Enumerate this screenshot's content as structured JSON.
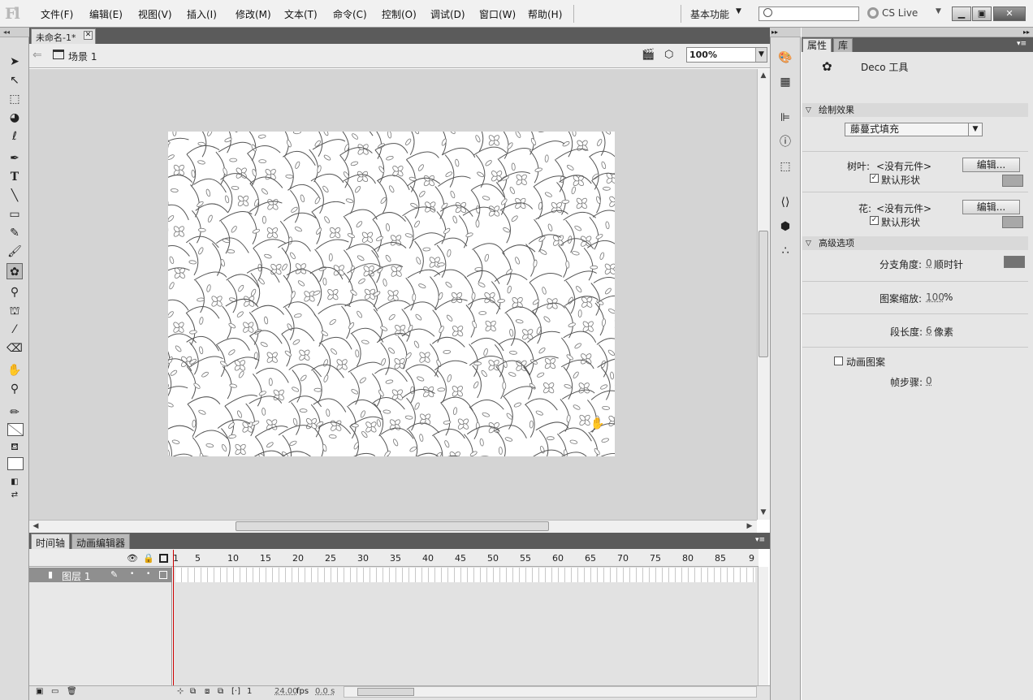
{
  "app": {
    "logo": "Fl"
  },
  "menu": [
    "文件(F)",
    "编辑(E)",
    "视图(V)",
    "插入(I)",
    "修改(M)",
    "文本(T)",
    "命令(C)",
    "控制(O)",
    "调试(D)",
    "窗口(W)",
    "帮助(H)"
  ],
  "workspace": {
    "label": "基本功能"
  },
  "cslive": {
    "label": "CS Live"
  },
  "document": {
    "tab_label": "未命名-1*",
    "scene_label": "场景 1",
    "zoom": "100%"
  },
  "timeline": {
    "tabs": [
      "时间轴",
      "动画编辑器"
    ],
    "frame_numbers": [
      "1",
      "5",
      "10",
      "15",
      "20",
      "25",
      "30",
      "35",
      "40",
      "45",
      "50",
      "55",
      "60",
      "65",
      "70",
      "75",
      "80",
      "85",
      "9"
    ],
    "layer_name": "图层 1",
    "current_frame": "1",
    "fps": "24.00",
    "fps_unit": "fps",
    "time": "0.0 s"
  },
  "panel": {
    "tabs": [
      "属性",
      "库"
    ],
    "tool_name": "Deco 工具",
    "drawing_effect": {
      "heading": "绘制效果",
      "selected": "藤蔓式填充"
    },
    "leaf": {
      "label": "树叶:",
      "value": "<没有元件>",
      "edit_button": "编辑...",
      "default_shape": "默认形状"
    },
    "flower": {
      "label": "花:",
      "value": "<没有元件>",
      "edit_button": "编辑...",
      "default_shape": "默认形状"
    },
    "advanced": {
      "heading": "高级选项",
      "branch_angle_label": "分支角度:",
      "branch_angle_value": "0",
      "branch_angle_unit": "顺时针",
      "pattern_scale_label": "图案缩放:",
      "pattern_scale_value": "100",
      "pattern_scale_unit": "%",
      "segment_length_label": "段长度:",
      "segment_length_value": "6",
      "segment_length_unit": "像素",
      "animate_label": "动画图案",
      "frame_step_label": "帧步骤:",
      "frame_step_value": "0"
    }
  },
  "colors": {
    "swatch": "#a8a8a8",
    "swatch_dark": "#737373"
  }
}
